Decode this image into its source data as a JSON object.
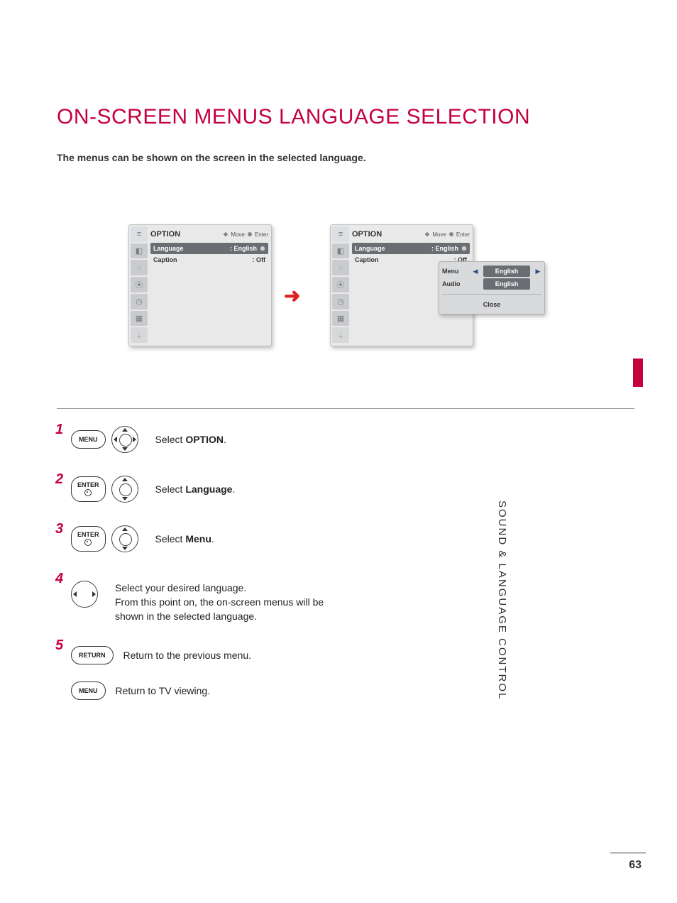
{
  "title": "ON-SCREEN MENUS LANGUAGE SELECTION",
  "intro": "The menus can be shown on the screen in the selected language.",
  "side_tab": "SOUND & LANGUAGE CONTROL",
  "page_number": "63",
  "osd": {
    "header_title": "OPTION",
    "hint_move": "Move",
    "hint_enter": "Enter",
    "rows": [
      {
        "label": "Language",
        "value": ": English"
      },
      {
        "label": "Caption",
        "value": ": Off"
      }
    ]
  },
  "popout": {
    "rows": [
      {
        "label": "Menu",
        "value": "English"
      },
      {
        "label": "Audio",
        "value": "English"
      }
    ],
    "close": "Close"
  },
  "steps": [
    {
      "num": "1",
      "button": "MENU",
      "dpad": "all",
      "text_pre": "Select ",
      "text_bold": "OPTION",
      "text_post": "."
    },
    {
      "num": "2",
      "button": "ENTER",
      "dpad": "ud",
      "text_pre": "Select ",
      "text_bold": "Language",
      "text_post": "."
    },
    {
      "num": "3",
      "button": "ENTER",
      "dpad": "ud",
      "text_pre": "Select ",
      "text_bold": "Menu",
      "text_post": "."
    },
    {
      "num": "4",
      "button": "",
      "dpad": "lr",
      "text_pre": "",
      "text_bold": "",
      "text_post": "Select your desired language.\nFrom this point on, the on-screen menus will be shown in the selected language."
    },
    {
      "num": "5",
      "button": "RETURN",
      "dpad": "",
      "text_pre": "",
      "text_bold": "",
      "text_post": "Return to the previous menu."
    },
    {
      "num": "",
      "button": "MENU",
      "dpad": "",
      "text_pre": "",
      "text_bold": "",
      "text_post": "Return to TV viewing."
    }
  ]
}
